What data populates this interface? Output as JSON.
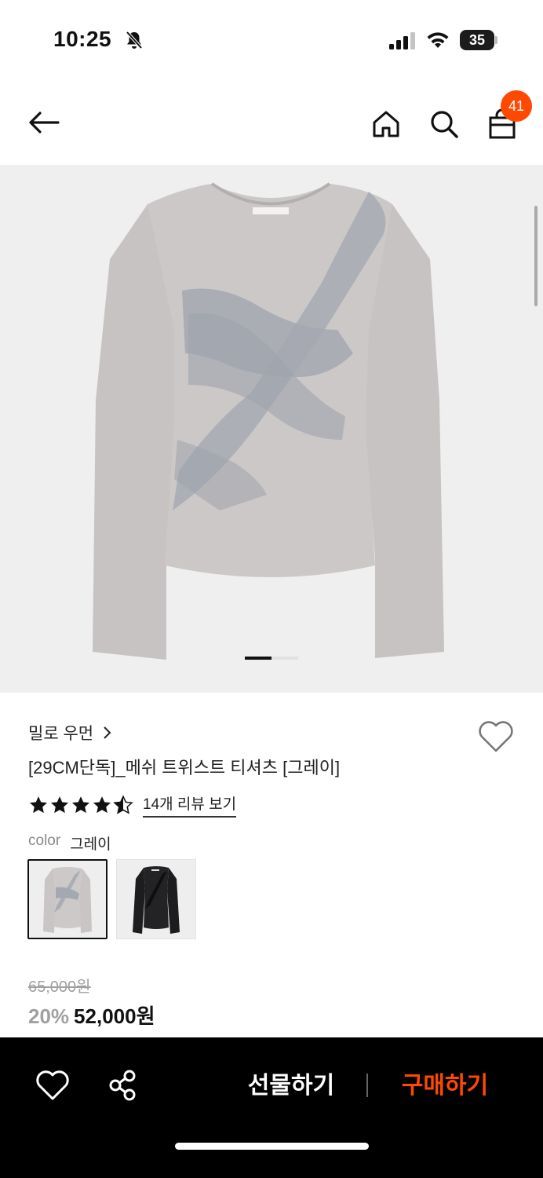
{
  "status_bar": {
    "time": "10:25",
    "battery": "35",
    "icons": [
      "bell-slash-icon",
      "cellular-signal-icon",
      "wifi-icon",
      "battery-icon"
    ]
  },
  "nav": {
    "icons": [
      "arrow-left-icon",
      "home-icon",
      "search-icon",
      "shopping-bag-icon"
    ],
    "cart_count": "41"
  },
  "product": {
    "brand": "밀로 우먼",
    "title": "[29CM단독]_메쉬 트위스트 티셔츠 [그레이]",
    "rating": 4.5,
    "rating_max": 5,
    "review_link": "14개 리뷰 보기",
    "color_label": "color",
    "color_value": "그레이",
    "swatches": [
      "gray",
      "black"
    ],
    "image_index": 1,
    "original_price": "65,000원",
    "discount_rate": "20%",
    "sale_price": "52,000원"
  },
  "bottom_bar": {
    "gift_label": "선물하기",
    "buy_label": "구매하기",
    "icons": [
      "heart-icon",
      "share-icon"
    ]
  },
  "colors": {
    "accent": "#ff4800",
    "image_bg": "#efefef",
    "shirt_gray": "#c9c5c4",
    "mesh_gray": "#a7abb2",
    "bottom_bar_bg": "#000000"
  }
}
